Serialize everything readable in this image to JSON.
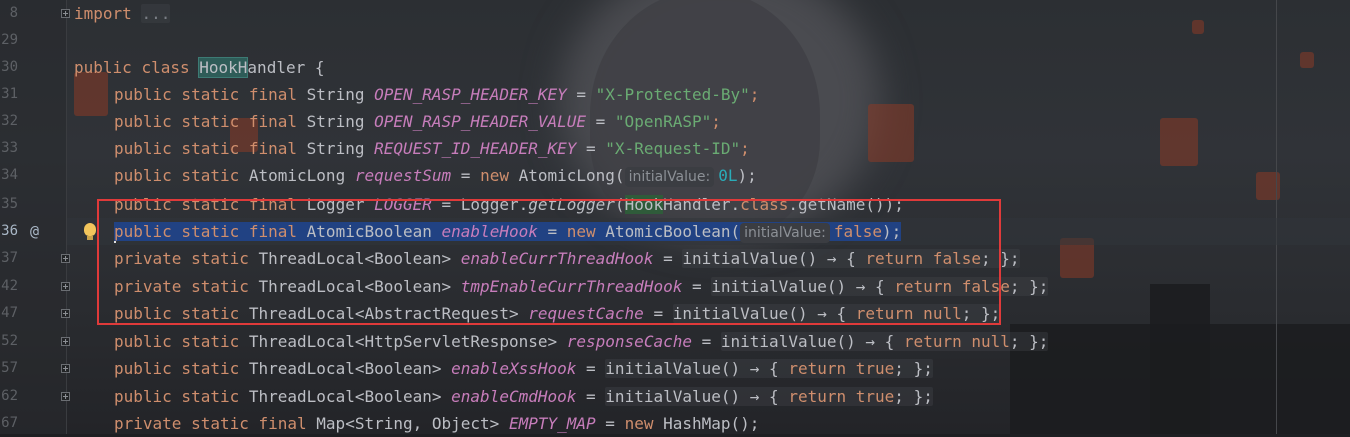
{
  "editor": {
    "gutter_marker_at": "@",
    "line_numbers": [
      "8",
      "29",
      "30",
      "31",
      "32",
      "33",
      "34",
      "35",
      "36",
      "37",
      "42",
      "47",
      "52",
      "57",
      "62",
      "67"
    ],
    "lines": {
      "l8": {
        "import": "import",
        "dots": "..."
      },
      "l30": {
        "public": "public",
        "class": "class",
        "name_hl": "HookH",
        "name_rest": "andler",
        "brace": " {"
      },
      "l31": {
        "mods": "public static final",
        "type": " String ",
        "field": "OPEN_RASP_HEADER_KEY",
        "eq": " = ",
        "value": "\"X-Protected-By\"",
        "semi": ";"
      },
      "l32": {
        "mods": "public static final",
        "type": " String ",
        "field": "OPEN_RASP_HEADER_VALUE",
        "eq": " = ",
        "value": "\"OpenRASP\"",
        "semi": ";"
      },
      "l33": {
        "mods": "public static final",
        "type": " String ",
        "field": "REQUEST_ID_HEADER_KEY",
        "eq": " = ",
        "value": "\"X-Request-ID\"",
        "semi": ";"
      },
      "l34": {
        "mods": "public static",
        "type": " AtomicLong ",
        "field": "requestSum",
        "eq": " = ",
        "new": "new",
        "ctor": " AtomicLong(",
        "hint": "initialValue:",
        "num": "0L",
        "end": ");"
      },
      "l35": {
        "mods": "public static final",
        "type": " Logger ",
        "field": "LOGGER",
        "eq": " = ",
        "call1": "Logger.",
        "call2": "getLogger",
        "paren": "(",
        "hook": "Hook",
        "rest": "Handler.",
        "cls": "class",
        "tail": ".getName());"
      },
      "l36": {
        "mods": "public static final",
        "type": " AtomicBoolean ",
        "field": "enableHook",
        "eq": " = ",
        "new": "new",
        "ctor": " AtomicBoolean(",
        "hint": "initialValue:",
        "val": "false",
        "end": ");"
      },
      "l37": {
        "mods": "private static",
        "type": " ThreadLocal<Boolean> ",
        "field": "enableCurrThreadHook",
        "eq": " = ",
        "call": "initialValue() → { ",
        "ret": "return",
        "val": " false",
        "end": "; };"
      },
      "l42": {
        "mods": "private static",
        "type": " ThreadLocal<Boolean> ",
        "field": "tmpEnableCurrThreadHook",
        "eq": " = ",
        "call": "initialValue() → { ",
        "ret": "return",
        "val": " false",
        "end": "; };"
      },
      "l47": {
        "mods": "public static",
        "type": " ThreadLocal<AbstractRequest> ",
        "field": "requestCache",
        "eq": " = ",
        "call": "initialValue() → { ",
        "ret": "return",
        "val": " null",
        "end": "; };"
      },
      "l52": {
        "mods": "public static",
        "type": " ThreadLocal<HttpServletResponse> ",
        "field": "responseCache",
        "eq": " = ",
        "call": "initialValue() → { ",
        "ret": "return",
        "val": " null",
        "end": "; };"
      },
      "l57": {
        "mods": "public static",
        "type": " ThreadLocal<Boolean> ",
        "field": "enableXssHook",
        "eq": " = ",
        "call": "initialValue() → { ",
        "ret": "return",
        "val": " true",
        "end": "; };"
      },
      "l62": {
        "mods": "public static",
        "type": " ThreadLocal<Boolean> ",
        "field": "enableCmdHook",
        "eq": " = ",
        "call": "initialValue() → { ",
        "ret": "return",
        "val": " true",
        "end": "; };"
      },
      "l67": {
        "mods": "private static final",
        "type": " Map<String, Object> ",
        "field": "EMPTY_MAP",
        "eq": " = ",
        "new": "new",
        "ctor": " HashMap();"
      }
    }
  },
  "colors": {
    "keyword": "#cf8e6d",
    "field": "#c77dbb",
    "string": "#6aab73",
    "number": "#2aacb8",
    "selection": "#214283",
    "annotation_box": "#e03a3a"
  }
}
